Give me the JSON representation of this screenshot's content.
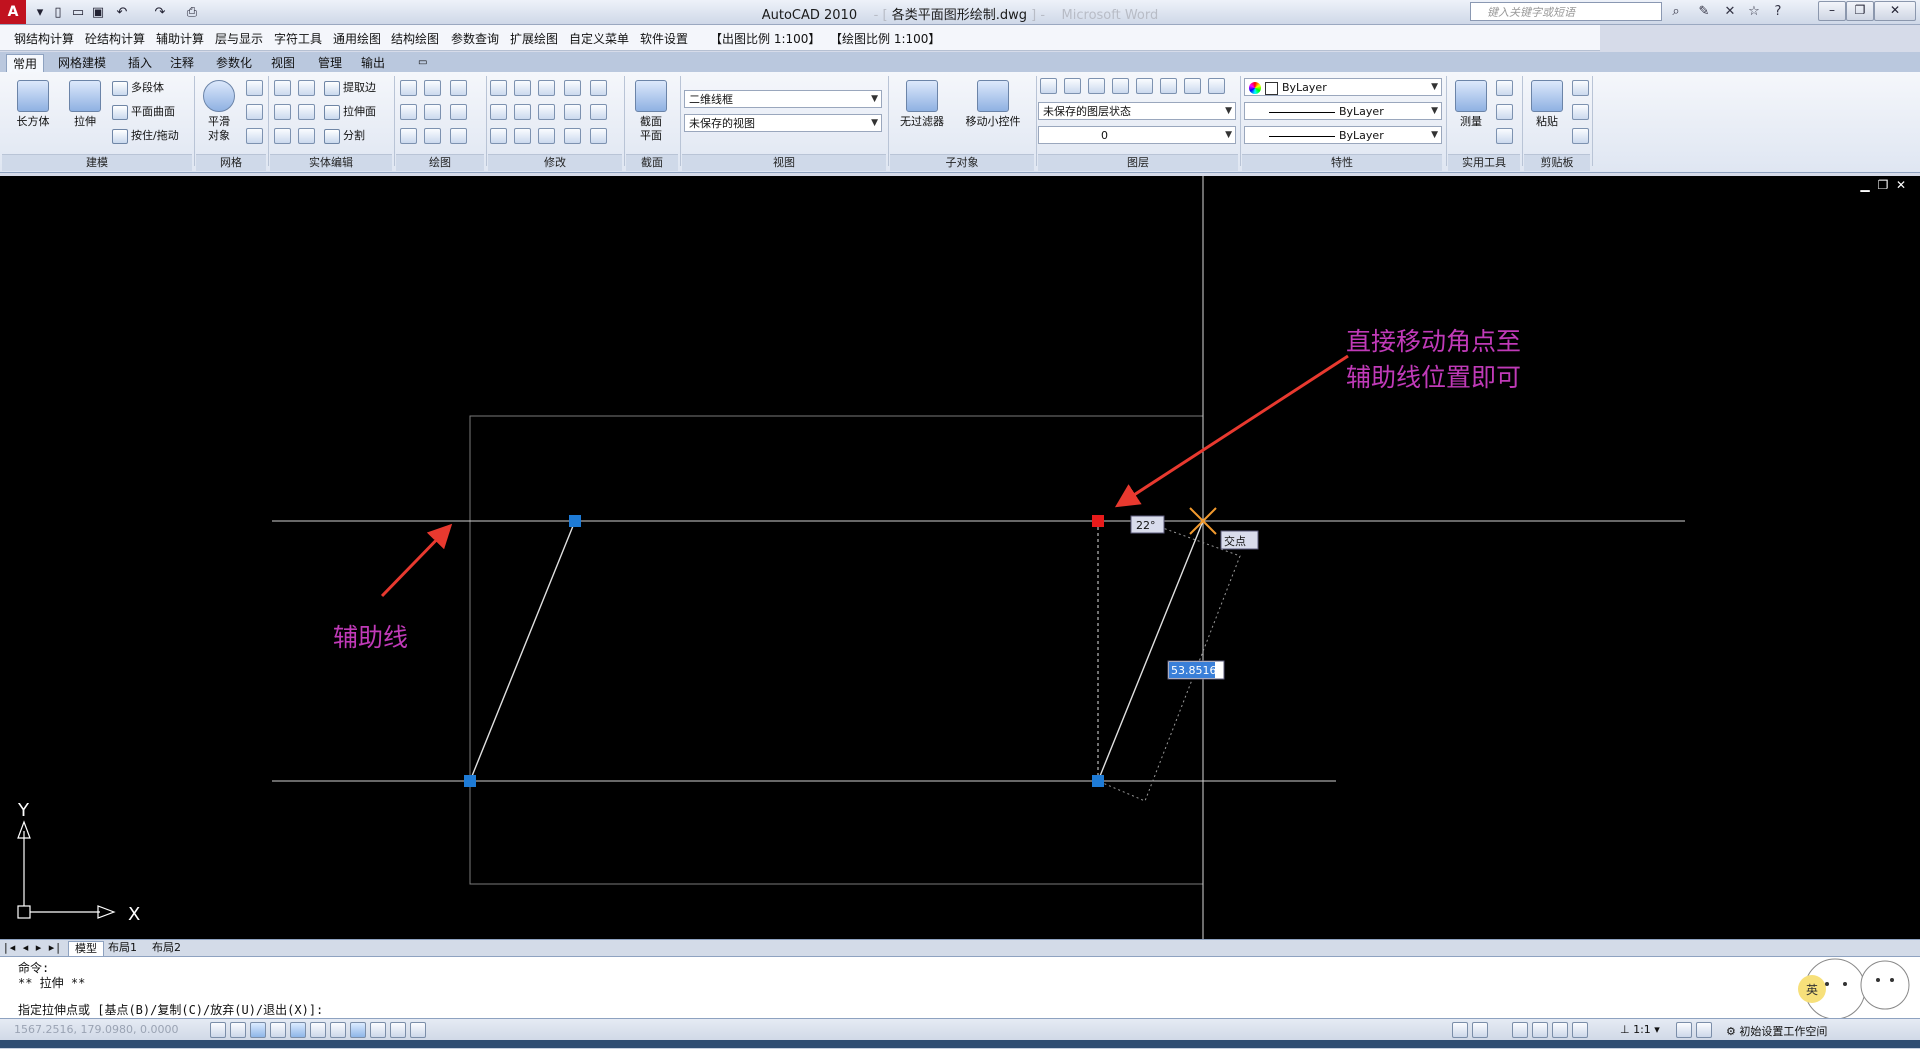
{
  "titlebar": {
    "app": "AutoCAD 2010",
    "file": "各类平面图形绘制.dwg",
    "faint": "Microsoft Word",
    "search_placeholder": "键入关键字或短语"
  },
  "menu": [
    "钢结构计算",
    "砼结构计算",
    "辅助计算",
    "层与显示",
    "字符工具",
    "通用绘图",
    "结构绘图",
    "参数查询",
    "扩展绘图",
    "自定义菜单",
    "软件设置",
    "【出图比例 1:100】",
    "【绘图比例 1:100】"
  ],
  "ribbon_tabs": [
    "常用",
    "网格建模",
    "插入",
    "注释",
    "参数化",
    "视图",
    "管理",
    "输出"
  ],
  "ribbon": {
    "modeling": {
      "box": "长方体",
      "extrude": "拉伸",
      "polysolid": "多段体",
      "planar": "平面曲面",
      "presspull": "按住/拖动"
    },
    "mesh": {
      "smooth": "平滑",
      "smooth2": "对象"
    },
    "solid_edit": {
      "extract": "提取边",
      "extrude_face": "拉伸面",
      "split": "分割"
    },
    "section": {
      "label1": "截面",
      "label2": "平面"
    },
    "view": {
      "visual_style": "二维线框",
      "saved_view": "未保存的视图"
    },
    "subobject": {
      "filter": "无过滤器",
      "gizmo": "移动小控件"
    },
    "layers": {
      "state": "未保存的图层状态",
      "current": "0"
    },
    "properties": {
      "color": "ByLayer",
      "linetype": "ByLayer",
      "lineweight": "ByLayer"
    },
    "utilities": {
      "measure": "测量"
    },
    "clipboard": {
      "paste": "粘贴"
    },
    "panel_titles": [
      "建模",
      "网格",
      "实体编辑",
      "绘图",
      "修改",
      "截面",
      "视图",
      "子对象",
      "图层",
      "特性",
      "实用工具",
      "剪贴板"
    ]
  },
  "canvas": {
    "annotation_top_line1": "直接移动角点至",
    "annotation_top_line2": "辅助线位置即可",
    "annotation_left": "辅助线",
    "angle_tooltip": "22°",
    "snap_tooltip": "交点",
    "length_input": "53.8516",
    "ucs_x": "X",
    "ucs_y": "Y",
    "accent_color": "#c03ab8",
    "arrow_color": "#e8392f"
  },
  "layout_tabs": [
    "模型",
    "布局1",
    "布局2"
  ],
  "command": {
    "line1": "命令:",
    "line2": "** 拉伸 **",
    "line3": "指定拉伸点或 [基点(B)/复制(C)/放弃(U)/退出(X)]:"
  },
  "status": {
    "coords": "1567.2516, 179.0980, 0.0000",
    "scale": "1:1",
    "workspace": "初始设置工作空间"
  }
}
